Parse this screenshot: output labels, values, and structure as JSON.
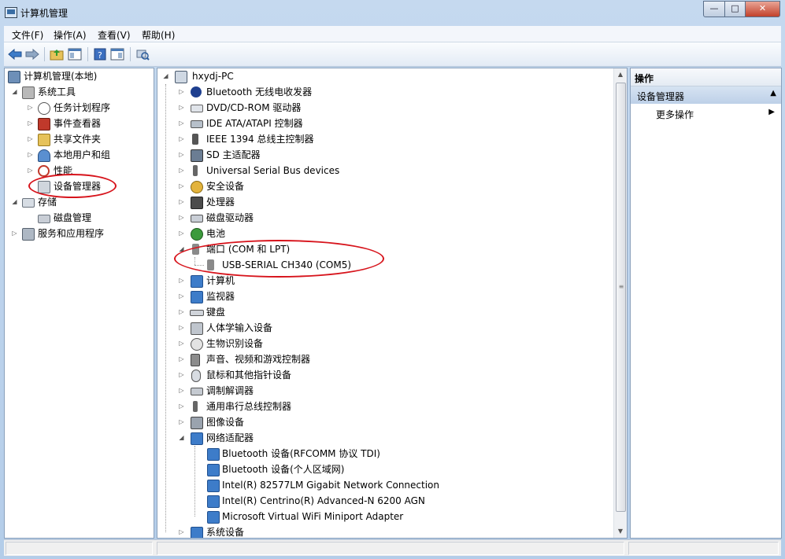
{
  "window": {
    "title": "计算机管理",
    "buttons": {
      "minimize": "—",
      "maximize": "□",
      "close": "✕"
    }
  },
  "menubar": [
    "文件(F)",
    "操作(A)",
    "查看(V)",
    "帮助(H)"
  ],
  "toolbar": [
    "back-icon",
    "forward-icon",
    "up-folder-icon",
    "console-tree-icon",
    "help-icon",
    "show-hide-icon",
    "scan-hardware-icon"
  ],
  "left_tree": {
    "root": "计算机管理(本地)",
    "system_tools": "系统工具",
    "task_scheduler": "任务计划程序",
    "event_viewer": "事件查看器",
    "shared_folders": "共享文件夹",
    "local_users": "本地用户和组",
    "performance": "性能",
    "device_manager": "设备管理器",
    "storage": "存储",
    "disk_management": "磁盘管理",
    "services_apps": "服务和应用程序"
  },
  "device_tree": {
    "computer": "hxydj-PC",
    "bluetooth": "Bluetooth 无线电收发器",
    "dvd": "DVD/CD-ROM 驱动器",
    "ide": "IDE ATA/ATAPI 控制器",
    "ieee1394": "IEEE 1394 总线主控制器",
    "sd": "SD 主适配器",
    "usb_devices": "Universal Serial Bus devices",
    "security": "安全设备",
    "processor": "处理器",
    "disk_drives": "磁盘驱动器",
    "battery": "电池",
    "ports": "端口 (COM 和 LPT)",
    "usb_serial": "USB-SERIAL CH340 (COM5)",
    "computer_cat": "计算机",
    "monitors": "监视器",
    "keyboards": "键盘",
    "hid": "人体学输入设备",
    "biometric": "生物识别设备",
    "sound": "声音、视频和游戏控制器",
    "mice": "鼠标和其他指针设备",
    "modems": "调制解调器",
    "usb_controllers": "通用串行总线控制器",
    "imaging": "图像设备",
    "network": "网络适配器",
    "net1": "Bluetooth 设备(RFCOMM 协议 TDI)",
    "net2": "Bluetooth 设备(个人区域网)",
    "net3": "Intel(R) 82577LM Gigabit Network Connection",
    "net4": "Intel(R) Centrino(R) Advanced-N 6200 AGN",
    "net5": "Microsoft Virtual WiFi Miniport Adapter",
    "system_devices": "系统设备"
  },
  "actions": {
    "header": "操作",
    "section": "设备管理器",
    "more": "更多操作"
  },
  "colors": {
    "annotation_red": "#d7141c",
    "section_blue": "#c8d9ee"
  }
}
